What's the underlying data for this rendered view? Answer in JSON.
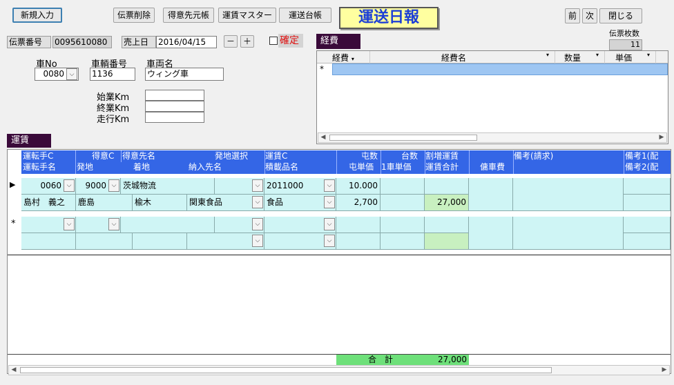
{
  "toolbar": {
    "new_entry": "新規入力",
    "delete_slip": "伝票削除",
    "customer_ledger": "得意先元帳",
    "freight_master": "運賃マスター",
    "transport_ledger": "運送台帳",
    "prev": "前",
    "next": "次",
    "close": "閉じる"
  },
  "title": "運送日報",
  "slip": {
    "number_label": "伝票番号",
    "number_value": "0095610080",
    "sales_date_label": "売上日",
    "sales_date_value": "2016/04/15",
    "minus": "－",
    "plus": "＋",
    "confirm_label": "確定",
    "slip_count_label": "伝票枚数",
    "slip_count_value": "11"
  },
  "vehicle": {
    "car_no_label": "車No",
    "car_no_value": "0080",
    "vehicle_number_label": "車輌番号",
    "vehicle_number_value": "1136",
    "vehicle_name_label": "車両名",
    "vehicle_name_value": "ウィング車",
    "start_km_label": "始業Km",
    "end_km_label": "終業Km",
    "run_km_label": "走行Km"
  },
  "expenses": {
    "tab_label": "経費",
    "columns": [
      "経費",
      "経費名",
      "数量",
      "単価"
    ],
    "new_row_marker": "*"
  },
  "freight": {
    "tab_label": "運賃",
    "header_row1": [
      "運転手C",
      "得意C",
      "得意先名",
      "発地選択",
      "運賃C",
      "屯数",
      "台数",
      "割増運賃",
      "",
      "備考(請求)",
      "備考1(配"
    ],
    "header_row2": [
      "運転手名",
      "発地",
      "着地",
      "納入先名",
      "積載品名",
      "屯単価",
      "1車単価",
      "運賃合計",
      "傭車費",
      "",
      "備考2(配"
    ],
    "rows": [
      {
        "marker": "▶",
        "driver_code": "0060",
        "customer_code": "9000",
        "customer_name": "茨城物流",
        "freight_code": "2011000",
        "tonnage": "10.000",
        "driver_name": "島村　義之",
        "origin": "鹿島",
        "destination": "楡木",
        "delivery_name": "関東食品",
        "cargo_name": "食品",
        "ton_unit_price": "2,700",
        "freight_total": "27,000"
      }
    ],
    "new_row_marker": "*",
    "total_label": "合　計",
    "total_value": "27,000"
  },
  "colors": {
    "header_blue": "#3466e6",
    "cell_cyan": "#cff5f5",
    "total_green": "#c8f0c0",
    "title_yellow": "#ffffa0",
    "title_text": "#1d3fd6",
    "tab_purple": "#3a0a3a",
    "confirm_red": "#e01010"
  }
}
